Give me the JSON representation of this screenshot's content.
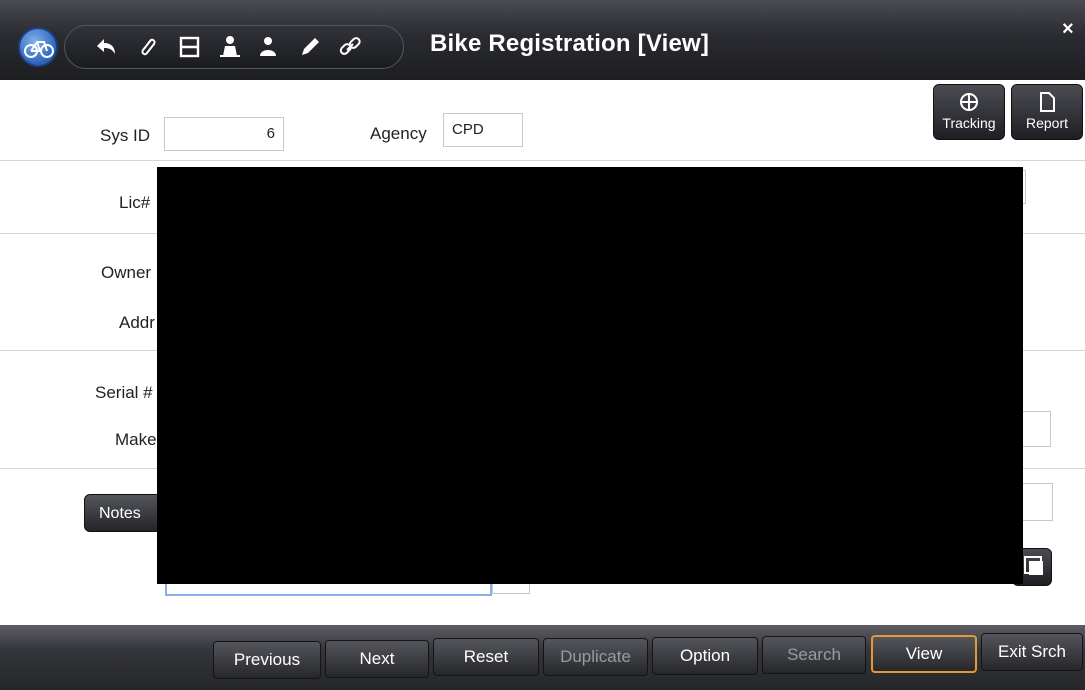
{
  "window": {
    "title": "Bike Registration [View]",
    "close": "×"
  },
  "toolbar_icons": [
    "undo-icon",
    "paperclip-icon",
    "clip-icon",
    "save-icon",
    "person-alert-icon",
    "person-icon",
    "pencil-icon",
    "link-icon"
  ],
  "form": {
    "sys_id": {
      "label": "Sys ID",
      "value": "6"
    },
    "agency": {
      "label": "Agency",
      "value": "CPD"
    },
    "lic_label": "Lic#",
    "owner_label": "Owner",
    "address_label": "Addr",
    "serial_label": "Serial #",
    "make_label": "Make"
  },
  "side_buttons": {
    "tracking": "Tracking",
    "report": "Report"
  },
  "notes_label": "Notes",
  "bottom_buttons": [
    {
      "label": "Previous",
      "enabled": true
    },
    {
      "label": "Next",
      "enabled": true
    },
    {
      "label": "Reset",
      "enabled": true
    },
    {
      "label": "Duplicate",
      "enabled": false
    },
    {
      "label": "Option",
      "enabled": true
    },
    {
      "label": "Search",
      "enabled": false
    },
    {
      "label": "View",
      "enabled": true,
      "focused": true
    },
    {
      "label": "Exit Srch",
      "enabled": true
    }
  ],
  "colors": {
    "accent_focus": "#e49a33",
    "titlebar": "#2a2b30"
  }
}
